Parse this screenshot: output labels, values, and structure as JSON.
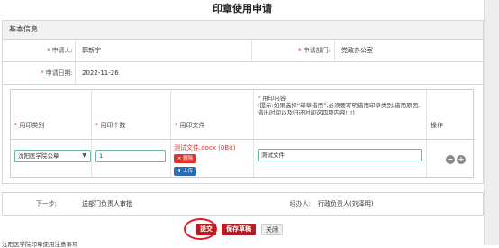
{
  "page": {
    "title": "印章使用申请"
  },
  "section": {
    "title": "基本信息"
  },
  "form": {
    "applicant_label": "申请人:",
    "applicant_value": "郭新宇",
    "dept_label": "申请部门:",
    "dept_value": "党政办公室",
    "date_label": "申请日期:",
    "date_value": "2022-11-26",
    "required_mark": "*"
  },
  "table": {
    "headers": {
      "seal_type": "用印类别",
      "count": "用印个数",
      "file": "用印文件",
      "content_label": "用印内容",
      "content_hint": "(提示:如果选择“印章借用”,必须要写明借用印章类别,借用原因,借出时间以及归还时间这四项内容!!!)",
      "action": "操作"
    },
    "row": {
      "seal_type_value": "沈阳医学院公章",
      "count_value": "1",
      "file_name": "测试文件.docx (0Bit)",
      "delete_label": "× 删除",
      "upload_label": "⬆ 上传",
      "content_value": "测试文件"
    }
  },
  "workflow": {
    "next_label": "下一步:",
    "next_value": "送部门负责人审批",
    "handler_label": "经办人:",
    "handler_value": "行政负责人(刘泽明)"
  },
  "actions": {
    "submit": "提交",
    "save_draft": "保存草稿",
    "close": "关闭"
  },
  "footer": {
    "text": "沈阳医学院印章使用注意事项"
  },
  "icons": {
    "caret": "▼",
    "minus": "−",
    "plus": "+"
  },
  "colors": {
    "primary": "#b81c22",
    "required": "#e0312f",
    "upload": "#2b6cb3",
    "focus_border": "#6cba9d"
  }
}
